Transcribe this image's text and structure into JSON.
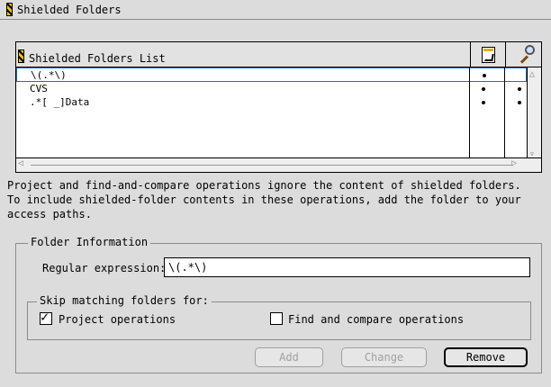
{
  "window": {
    "title": "Shielded Folders"
  },
  "list": {
    "header_title": "Shielded Folders List",
    "columns": [
      {
        "icon": "document-icon"
      },
      {
        "icon": "magnifier-icon"
      }
    ],
    "rows": [
      {
        "name": "\\(.*\\)",
        "project": true,
        "find": false,
        "selected": true
      },
      {
        "name": "CVS",
        "project": true,
        "find": true,
        "selected": false
      },
      {
        "name": ".*[ _]Data",
        "project": true,
        "find": true,
        "selected": false
      }
    ]
  },
  "description": "Project and find-and-compare operations ignore the content of shielded folders. To include shielded-folder contents in these operations, add the folder to your access paths.",
  "folder_info": {
    "legend": "Folder Information",
    "regex_label": "Regular expression:",
    "regex_value": "\\(.*\\)",
    "skip": {
      "legend": "Skip matching folders for:",
      "project_label": "Project operations",
      "project_checked": true,
      "find_label": "Find and compare operations",
      "find_checked": false
    }
  },
  "buttons": {
    "add": "Add",
    "change": "Change",
    "remove": "Remove"
  }
}
